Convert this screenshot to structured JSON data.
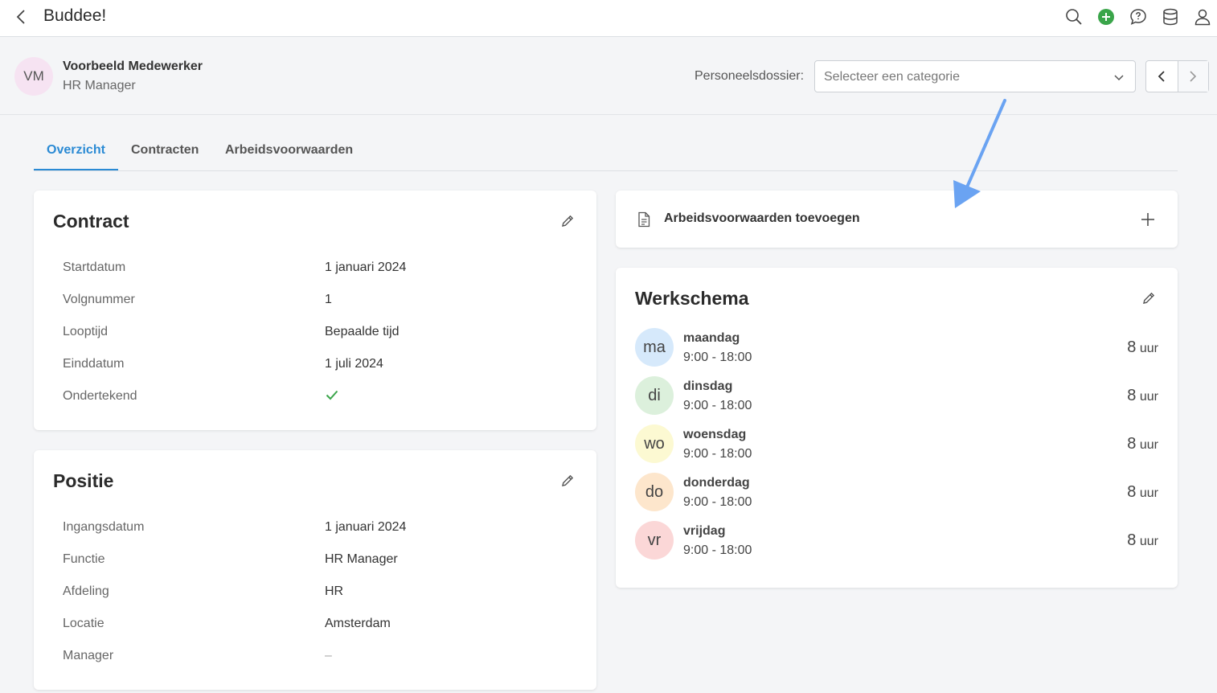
{
  "topbar": {
    "title": "Buddee!",
    "icons": [
      "chevron-left-icon",
      "search-icon",
      "plus-circle-icon",
      "chat-help-icon",
      "database-icon",
      "user-icon"
    ]
  },
  "employee": {
    "initials": "VM",
    "name": "Voorbeeld Medewerker",
    "role": "HR Manager"
  },
  "dossier": {
    "label": "Personeelsdossier:",
    "placeholder": "Selecteer een categorie"
  },
  "tabs": [
    {
      "label": "Overzicht",
      "active": true
    },
    {
      "label": "Contracten",
      "active": false
    },
    {
      "label": "Arbeidsvoorwaarden",
      "active": false
    }
  ],
  "contract": {
    "title": "Contract",
    "rows": [
      {
        "label": "Startdatum",
        "value": "1 januari 2024"
      },
      {
        "label": "Volgnummer",
        "value": "1"
      },
      {
        "label": "Looptijd",
        "value": "Bepaalde tijd"
      },
      {
        "label": "Einddatum",
        "value": "1 juli 2024"
      },
      {
        "label": "Ondertekend",
        "value": ""
      }
    ],
    "signed_icon": "check-icon"
  },
  "positie": {
    "title": "Positie",
    "rows": [
      {
        "label": "Ingangsdatum",
        "value": "1 januari 2024"
      },
      {
        "label": "Functie",
        "value": "HR Manager"
      },
      {
        "label": "Afdeling",
        "value": "HR"
      },
      {
        "label": "Locatie",
        "value": "Amsterdam"
      },
      {
        "label": "Manager",
        "value": "–"
      }
    ]
  },
  "arbeidsvoorwaarden": {
    "label": "Arbeidsvoorwaarden toevoegen"
  },
  "werkschema": {
    "title": "Werkschema",
    "days": [
      {
        "abbr": "ma",
        "name": "maandag",
        "time": "9:00 - 18:00",
        "hours": "8",
        "unit": "uur",
        "color": "#d6e9fb"
      },
      {
        "abbr": "di",
        "name": "dinsdag",
        "time": "9:00 - 18:00",
        "hours": "8",
        "unit": "uur",
        "color": "#dcf0dc"
      },
      {
        "abbr": "wo",
        "name": "woensdag",
        "time": "9:00 - 18:00",
        "hours": "8",
        "unit": "uur",
        "color": "#fcf9d2"
      },
      {
        "abbr": "do",
        "name": "donderdag",
        "time": "9:00 - 18:00",
        "hours": "8",
        "unit": "uur",
        "color": "#fde6cc"
      },
      {
        "abbr": "vr",
        "name": "vrijdag",
        "time": "9:00 - 18:00",
        "hours": "8",
        "unit": "uur",
        "color": "#fbd7d7"
      }
    ]
  },
  "colors": {
    "accent": "#2a8ad4",
    "add_icon_green": "#3aa54a",
    "check_green": "#3aa54a",
    "annotation_arrow": "#6aa3f2"
  }
}
